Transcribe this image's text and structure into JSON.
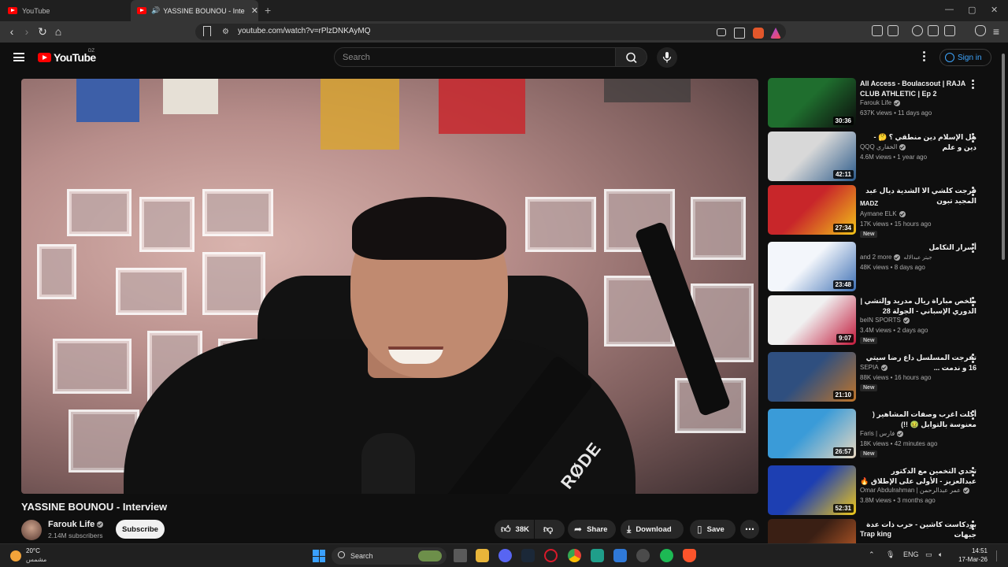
{
  "browser": {
    "tabs": [
      {
        "title": "YouTube",
        "active": false
      },
      {
        "title": "YASSINE BOUNOU - Interview",
        "active": true
      }
    ],
    "new_tab_symbol": "+",
    "url": "youtube.com/watch?v=rPlzDNKAyMQ",
    "window_controls": [
      "—",
      "▢",
      "✕"
    ]
  },
  "youtube_header": {
    "logo_text": "YouTube",
    "country_code": "DZ",
    "search_placeholder": "Search",
    "sign_in_label": "Sign in"
  },
  "video": {
    "title": "YASSINE BOUNOU - Interview",
    "overlay_brand": "RØDE",
    "channel": {
      "name": "Farouk Life",
      "subscribers": "2.14M subscribers",
      "verified": true
    },
    "subscribe_label": "Subscribe",
    "actions": {
      "like_count": "38K",
      "share_label": "Share",
      "download_label": "Download",
      "save_label": "Save"
    }
  },
  "recommendations": [
    {
      "title": "All Access - Boulacsout | RAJA CLUB ATHLETIC | Ep 2",
      "rtl": false,
      "channel": "Farouk Life",
      "verified": true,
      "meta": "637K views • 11 days ago",
      "duration": "30:36",
      "is_new": false,
      "thumb_colors": [
        "#1f6e2e",
        "#0c0c0c"
      ]
    },
    {
      "title": "هل الإسلام دين منطقي ؟ 🤔 - دين و علم",
      "rtl": true,
      "channel": "QQQ الخفاري",
      "verified": true,
      "meta": "4.6M views • 1 year ago",
      "duration": "42:11",
      "is_new": false,
      "thumb_colors": [
        "#d8d8d8",
        "#2b5a8a"
      ]
    },
    {
      "title": "فرجت كلشي الا الشدية ديال عبد المجيد تبون",
      "rtl": true,
      "channel": "MADZ",
      "channel2": "Aymane ELK",
      "verified": true,
      "meta": "17K views • 15 hours ago",
      "duration": "27:34",
      "is_new": true,
      "thumb_colors": [
        "#c8262a",
        "#f2c418"
      ]
    },
    {
      "title": "أسرار التكامل",
      "rtl": true,
      "channel": "and 2 more",
      "channel_extra": "جيتر عبدالاله",
      "verified": true,
      "meta": "48K views • 8 days ago",
      "duration": "23:48",
      "is_new": false,
      "thumb_colors": [
        "#f3f6fb",
        "#3d6fb4"
      ]
    },
    {
      "title": "ملخص مباراة ريال مدريد وإلتشي | الدوري الإسباني - الجولة 28",
      "rtl": true,
      "channel": "beIN SPORTS",
      "verified": true,
      "meta": "3.4M views • 2 days ago",
      "duration": "9:07",
      "is_new": true,
      "thumb_colors": [
        "#f0f0f0",
        "#c2183a"
      ]
    },
    {
      "title": "تفرجت المسلسل داع رضا سيتي 16 و ندمت ...",
      "rtl": true,
      "channel": "SEPIA",
      "verified": true,
      "meta": "88K views • 16 hours ago",
      "duration": "21:10",
      "is_new": true,
      "thumb_colors": [
        "#2f4f7f",
        "#c0752a"
      ]
    },
    {
      "title": "أكلت اغرب وصفات المشاهير ( معنوسة بالتوابل 🤢 !!)",
      "rtl": true,
      "channel": "Faris | فارس",
      "verified": true,
      "meta": "18K views • 42 minutes ago",
      "duration": "26:57",
      "is_new": true,
      "thumb_colors": [
        "#3a9bd8",
        "#e8d8c0"
      ]
    },
    {
      "title": "تحدي التخمين مع الدكتور عبدالعزيز - الأولى على الإطلاق 🔥",
      "rtl": true,
      "channel": "Omar Abdulrahman | عمر عبدالرحمن",
      "verified": true,
      "meta": "3.8M views • 3 months ago",
      "duration": "52:31",
      "is_new": false,
      "thumb_colors": [
        "#1d3fb2",
        "#f0c818"
      ]
    },
    {
      "title": "بودكاست كاشين - حرب ذات عدة جبهات",
      "rtl": true,
      "channel": "Trap king",
      "verified": false,
      "meta": "",
      "duration": "",
      "is_new": false,
      "thumb_colors": [
        "#3a1f14",
        "#d0642a"
      ]
    }
  ],
  "new_badge": "New",
  "taskbar": {
    "weather_temp": "20°C",
    "weather_condition": "مشمس",
    "search_label": "Search",
    "language": "ENG",
    "time": "14:51",
    "date": "17-Mar-26"
  }
}
